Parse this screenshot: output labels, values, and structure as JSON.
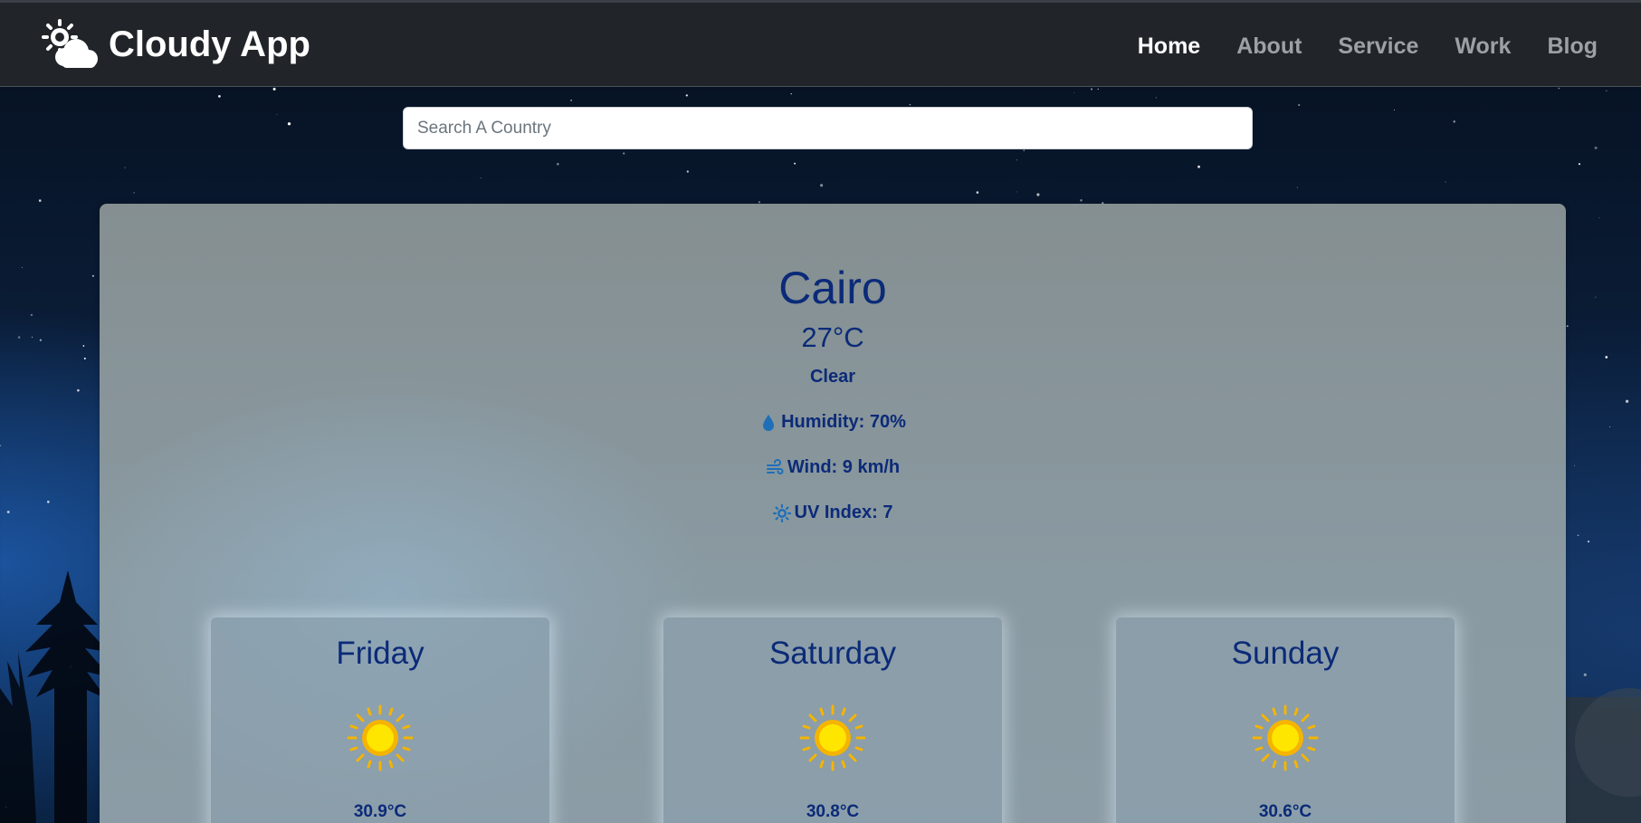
{
  "app": {
    "title": "Cloudy App"
  },
  "nav": {
    "items": [
      {
        "label": "Home",
        "active": true
      },
      {
        "label": "About",
        "active": false
      },
      {
        "label": "Service",
        "active": false
      },
      {
        "label": "Work",
        "active": false
      },
      {
        "label": "Blog",
        "active": false
      }
    ]
  },
  "search": {
    "placeholder": "Search A Country",
    "value": ""
  },
  "current": {
    "city": "Cairo",
    "temperature": "27°C",
    "condition": "Clear",
    "humidity": "Humidity: 70%",
    "wind": "Wind: 9 km/h",
    "uv_index": "UV Index: 7"
  },
  "forecast": [
    {
      "day": "Friday",
      "icon": "sun-icon",
      "temp": "30.9°C"
    },
    {
      "day": "Saturday",
      "icon": "sun-icon",
      "temp": "30.8°C"
    },
    {
      "day": "Sunday",
      "icon": "sun-icon",
      "temp": "30.6°C"
    }
  ],
  "colors": {
    "navbar": "#212529",
    "text_primary": "#0b2a78",
    "icon_blue": "#1f6fb8",
    "sun": "#ffd700",
    "sun_rays": "#f5b400"
  }
}
